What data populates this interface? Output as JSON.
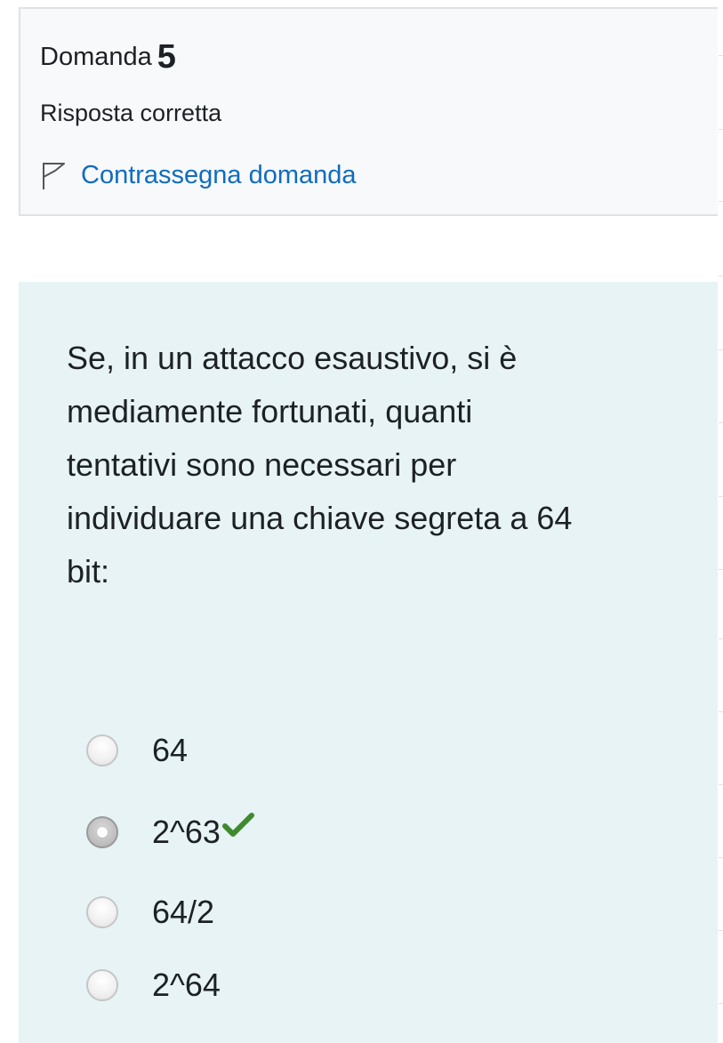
{
  "info": {
    "question_word": "Domanda",
    "question_number": "5",
    "state": "Risposta corretta",
    "flag_label": "Contrassegna domanda"
  },
  "question": {
    "lines": [
      "Se, in un attacco esaustivo, si è",
      "mediamente fortunati, quanti",
      "tentativi sono necessari per",
      "individuare una chiave segreta a 64",
      "bit:"
    ]
  },
  "options": [
    {
      "label": "64",
      "checked": false,
      "correct_mark": false
    },
    {
      "label": "2^63",
      "checked": true,
      "correct_mark": true
    },
    {
      "label": "64/2",
      "checked": false,
      "correct_mark": false
    },
    {
      "label": "2^64",
      "checked": false,
      "correct_mark": false
    }
  ],
  "colors": {
    "link": "#0f6cbf",
    "content_bg": "#e7f3f5",
    "info_bg": "#f8f9fa",
    "correct": "#3f8a2f"
  }
}
